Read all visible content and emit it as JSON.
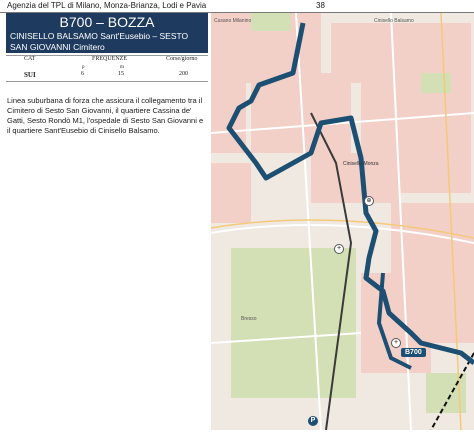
{
  "header": {
    "agency": "Agenzia del TPL di Milano, Monza-Brianza, Lodi e Pavia",
    "page_number": "38"
  },
  "line": {
    "id": "B700 – BOZZA",
    "route": "CINISELLO BALSAMO Sant'Eusebio – SESTO SAN GIOVANNI Cimitero"
  },
  "frequency_table": {
    "col_cat": "CAT",
    "col_freq": "FREQUENZE",
    "col_corse": "Corse/giorno",
    "sub_p": "p",
    "sub_m": "m",
    "cat_value": "SUI",
    "p_value": "6",
    "m_value": "15",
    "corse_value": "200"
  },
  "description": "Linea suburbana di forza che assicura il collegamento tra il Cimitero di Sesto San Giovanni, il quartiere Cassina de' Gatti, Sesto Rondò M1, l'ospedale di Sesto San Giovanni e il quartiere Sant'Eusebio di Cinisello Balsamo.",
  "map": {
    "labels": {
      "top_left": "Cusano Milanino",
      "top_right": "Cinisello Balsamo",
      "station": "Cinisello-Monza",
      "park": "Bresso",
      "line_tag": "B700"
    },
    "icons": [
      "hospital-icon",
      "metro-icon",
      "bus-stop-icon",
      "parking-icon"
    ],
    "colors": {
      "route": "#1d4f72",
      "route_tag_bg": "#1d4f72",
      "urban": "#f2cfc7",
      "green": "#d3dfb4",
      "rail": "#3a3a3a"
    }
  }
}
